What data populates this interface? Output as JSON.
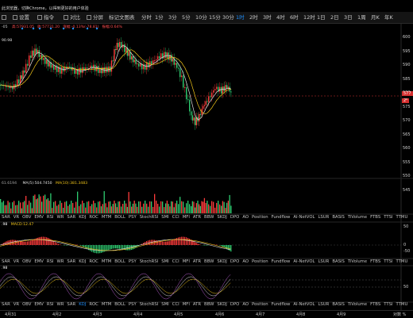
{
  "banner": "此浏览器，切换Chrome，以得到更好的用户体验",
  "toolbar": {
    "buttons": [
      "设置",
      "指令",
      "对比",
      "分屏",
      "标记文图表"
    ],
    "timeframes": [
      "分时",
      "1分",
      "3分",
      "5分",
      "10分",
      "15分",
      "30分",
      "1时",
      "2时",
      "3时",
      "4时",
      "6时",
      "12时",
      "1日",
      "2日",
      "3日",
      "1周",
      "月K",
      "年K"
    ],
    "active_timeframe": "1时"
  },
  "price_legend": {
    "left_text": "-05",
    "items": [
      {
        "label": "高:57931.05",
        "color": "#ff4d4f"
      },
      {
        "label": "收:57731.20",
        "color": "#ff4d4f"
      },
      {
        "label": "涨幅:-0.13%(-78.81)",
        "color": "#ff4d4f"
      },
      {
        "label": "振幅:0.64%",
        "color": "#ff4d4f"
      }
    ]
  },
  "ma_label": "90.98",
  "price_axis": {
    "ticks": [
      "600",
      "595",
      "590",
      "585",
      "580",
      "575",
      "570",
      "565",
      "560",
      "555",
      "550",
      "545"
    ],
    "current_price": "577",
    "current_tag": "2⁶"
  },
  "volume_legend": {
    "vol": "61.6194",
    "ma5": "MA(5):504.7450",
    "ma10": "MA(10):381.3483"
  },
  "indicator_tabs": [
    "SAR",
    "VR",
    "OBV",
    "EMV",
    "RSI",
    "WR",
    "SAR",
    "KDJ",
    "ROC",
    "MTM",
    "BOLL",
    "PSY",
    "StochRSI",
    "SMI",
    "CCI",
    "MFI",
    "ATR",
    "BBW",
    "SKDJ",
    "DPO",
    "AO",
    "Position",
    "Fundflow",
    "AI-NetVOL",
    "LSUR",
    "BASIS",
    "TiVolume",
    "FTBS",
    "TTSI",
    "TTMU"
  ],
  "macd_legend": {
    "left": ".98",
    "right": "MACD:12.47"
  },
  "macd_axis": {
    "ticks": [
      "50",
      "0",
      "-50"
    ]
  },
  "kdj_legend": {
    "left": ".98"
  },
  "kdj_axis": {
    "ticks": [
      "50"
    ]
  },
  "x_axis": {
    "ticks": [
      "4月31",
      "4月2",
      "4月3",
      "4月4",
      "4月5",
      "4月6",
      "4月7",
      "4月8",
      "4月9"
    ],
    "right": "对数 %"
  },
  "colors": {
    "up": "#ff3b3b",
    "down": "#2ecc71",
    "ma_white": "#e0e0e0",
    "ma_yellow": "#f0c419",
    "ma_purple": "#b85fd1"
  }
}
